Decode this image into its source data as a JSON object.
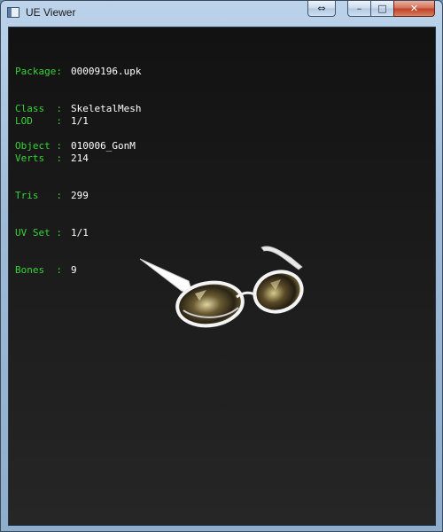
{
  "window": {
    "title": "UE Viewer",
    "buttons": {
      "swap": "⇔",
      "minimize": "–",
      "maximize": "□",
      "close": "✕"
    }
  },
  "info": {
    "header": [
      {
        "key": "Package:",
        "value": "00009196.upk"
      },
      {
        "key": "Class  :",
        "value": "SkeletalMesh"
      },
      {
        "key": "Object :",
        "value": "010006_GonM"
      }
    ],
    "stats": [
      {
        "key": "LOD    :",
        "value": "1/1"
      },
      {
        "key": "Verts  :",
        "value": "214"
      },
      {
        "key": "Tris   :",
        "value": "299"
      },
      {
        "key": "UV Set :",
        "value": "1/1"
      },
      {
        "key": "Bones  :",
        "value": "9"
      }
    ]
  },
  "colors": {
    "key": "#38d238",
    "value": "#ffffff",
    "viewport_bg": "#1a1a1a"
  },
  "icons": {
    "app": "ue-viewer-app-icon"
  }
}
